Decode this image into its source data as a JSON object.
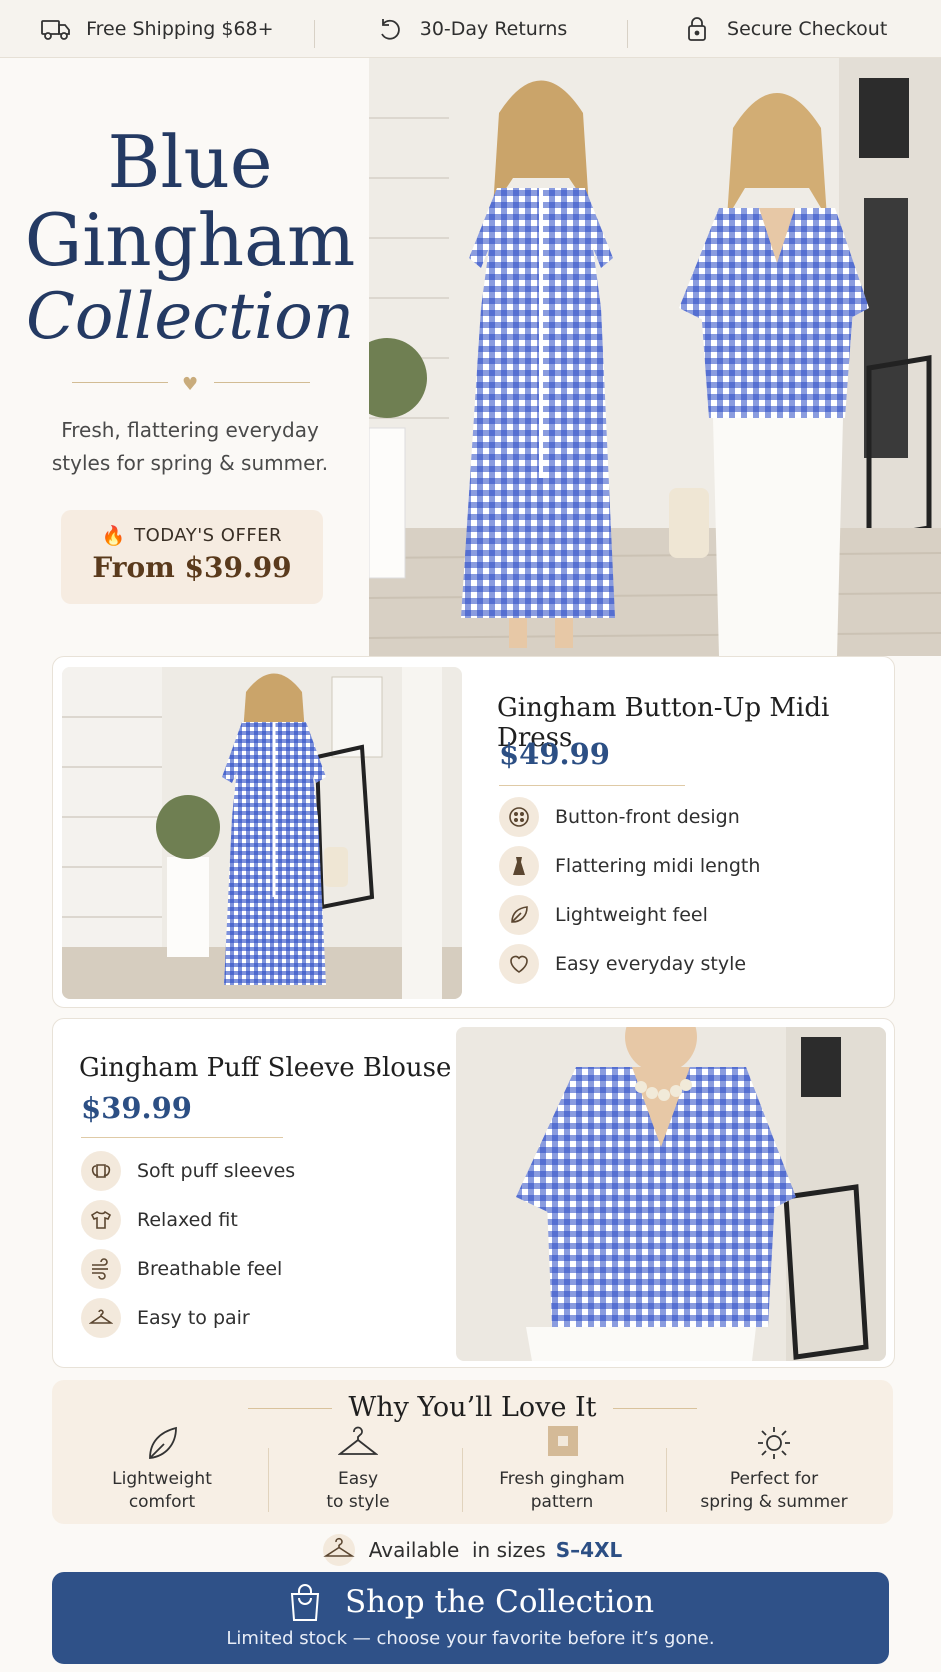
{
  "topbar": {
    "shipping": "Free Shipping $68+",
    "returns": "30-Day Returns",
    "checkout": "Secure Checkout"
  },
  "hero": {
    "title_line1": "Blue",
    "title_line2": "Gingham",
    "title_line3": "Collection",
    "tagline_line1": "Fresh, flattering everyday",
    "tagline_line2": "styles for spring & summer.",
    "offer_label": "TODAY'S OFFER",
    "offer_price": "From $39.99"
  },
  "products": [
    {
      "name": "Gingham Button-Up Midi Dress",
      "price": "$49.99",
      "features": [
        {
          "label": "Button-front design",
          "icon": "button-icon"
        },
        {
          "label": "Flattering midi length",
          "icon": "dress-icon"
        },
        {
          "label": "Lightweight feel",
          "icon": "leaf-icon"
        },
        {
          "label": "Easy everyday style",
          "icon": "heart-icon"
        }
      ]
    },
    {
      "name": "Gingham Puff Sleeve Blouse",
      "price": "$39.99",
      "features": [
        {
          "label": "Soft puff sleeves",
          "icon": "sleeve-icon"
        },
        {
          "label": "Relaxed fit",
          "icon": "shirt-icon"
        },
        {
          "label": "Breathable feel",
          "icon": "wind-icon"
        },
        {
          "label": "Easy to pair",
          "icon": "hanger-icon"
        }
      ]
    }
  ],
  "why": {
    "title": "Why You’ll Love It",
    "items": [
      {
        "line1": "Lightweight",
        "line2": "comfort"
      },
      {
        "line1": "Easy",
        "line2": "to style"
      },
      {
        "line1": "Fresh gingham",
        "line2": "pattern"
      },
      {
        "line1": "Perfect for",
        "line2": "spring & summer"
      }
    ]
  },
  "sizes": {
    "prefix": "Available  in sizes",
    "range": "S–4XL"
  },
  "cta": {
    "label": "Shop the Collection",
    "sublabel": "Limited stock — choose your favorite before it’s gone."
  },
  "colors": {
    "navy": "#243a63",
    "accent_blue": "#2f5188",
    "gingham_blue": "#2a4bc4",
    "beige": "#f6ece1",
    "gold": "#c9ac7c"
  }
}
